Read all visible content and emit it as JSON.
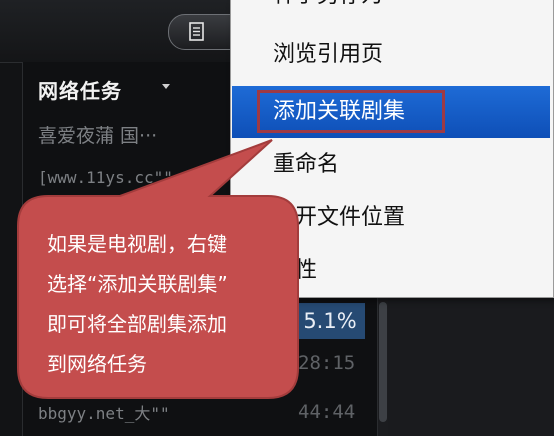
{
  "toolbar": {
    "doc_icon": "document-list-icon"
  },
  "task_list": {
    "header": "网络任务",
    "header_icon": "caret-down-icon",
    "rows": [
      {
        "title": "喜爱夜蒲  国···"
      },
      {
        "title": "[www.11ys.cc\"\""
      },
      {
        "title": "bbgyy.net_大\"\""
      }
    ],
    "selected_progress": "5.1%",
    "times": [
      "28:15",
      "44:44"
    ]
  },
  "context_menu": {
    "items": [
      {
        "label": "种子另存为···"
      },
      {
        "label": "浏览引用页"
      },
      {
        "label": "添加关联剧集"
      },
      {
        "label": "重命名"
      },
      {
        "label": "打开文件位置"
      },
      {
        "label": "属性"
      }
    ],
    "highlight_color": "#1a5fce",
    "outline_color": "#9e3a44"
  },
  "callout": {
    "lines": [
      "如果是电视剧，右键",
      "选择“添加关联剧集”",
      "即可将全部剧集添加",
      "到网络任务"
    ],
    "fill_color": "#c44d4d"
  }
}
